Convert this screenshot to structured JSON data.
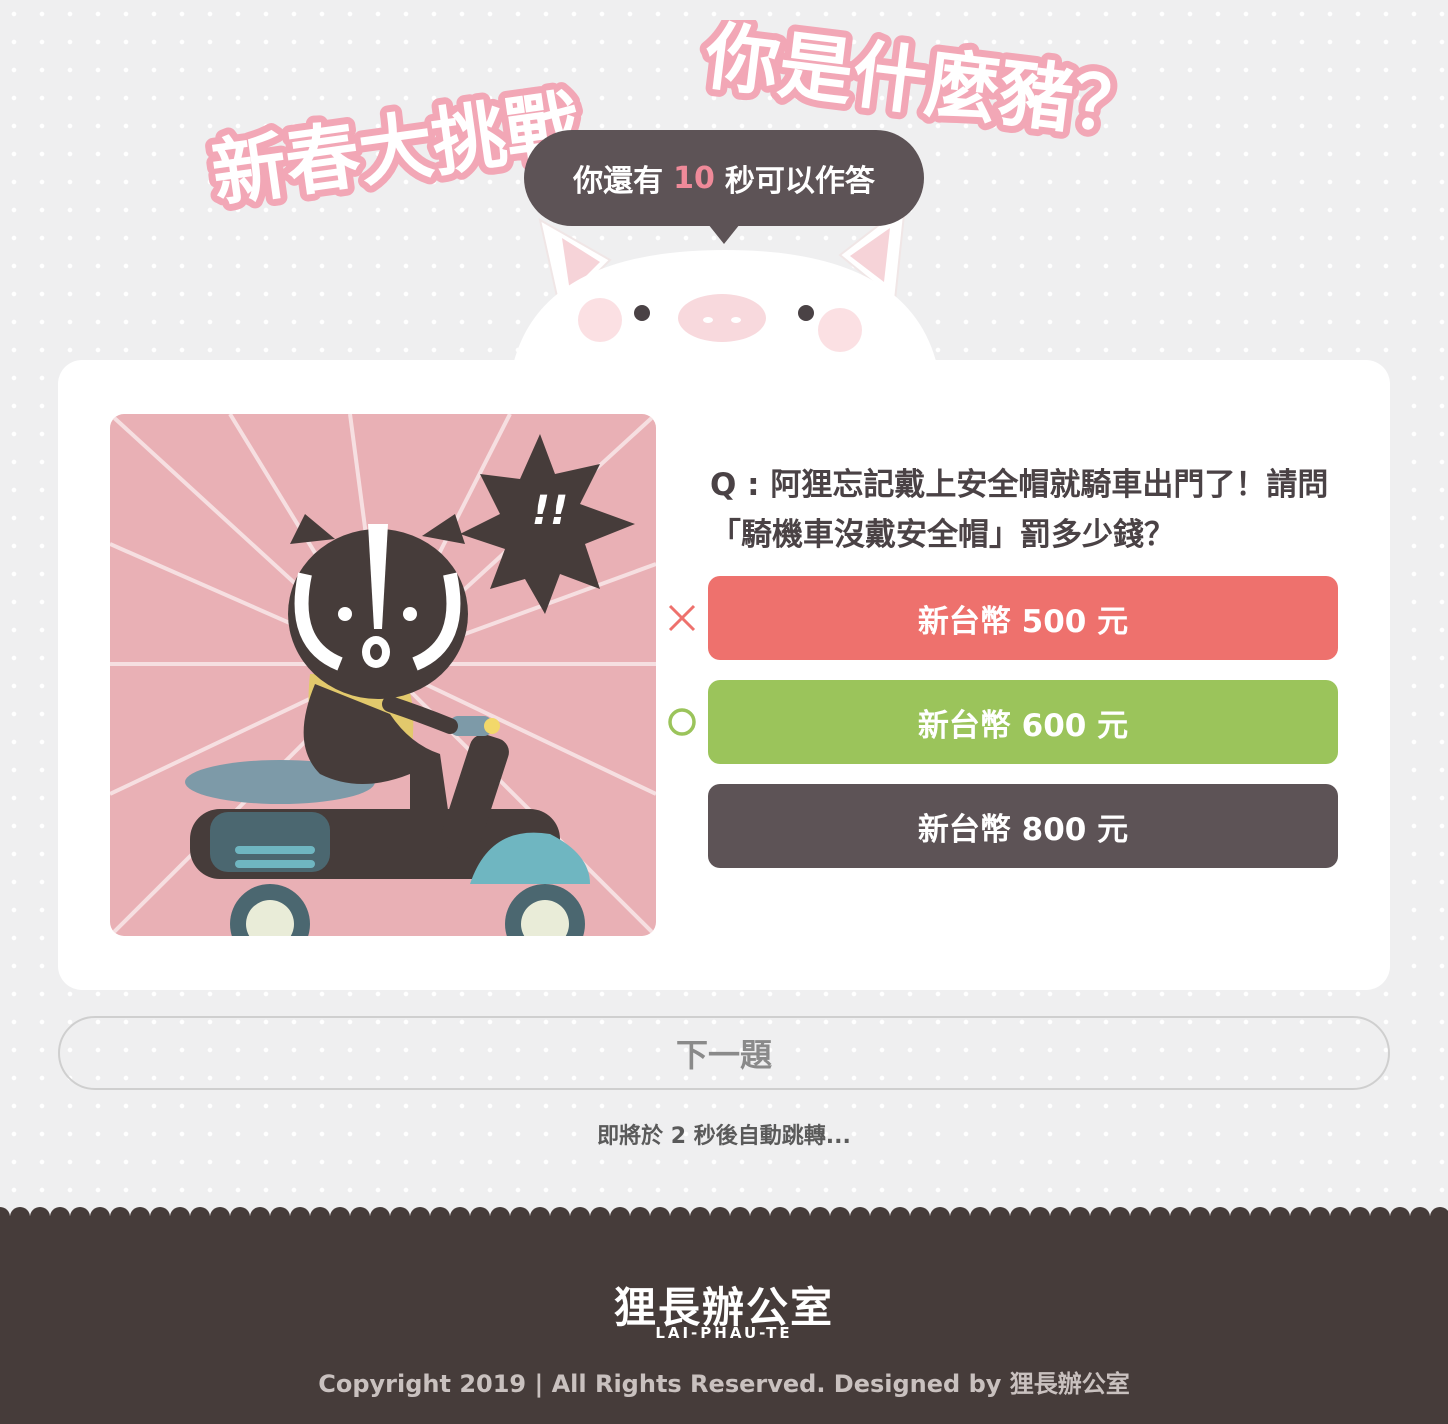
{
  "header": {
    "title_part1": "新春大挑戰",
    "title_part2": "你是什麼豬？",
    "timer_prefix": "你還有",
    "timer_seconds": "10",
    "timer_suffix": "秒可以作答"
  },
  "quiz": {
    "illustration_exclaim": "!!",
    "question": "Q : 阿狸忘記戴上安全帽就騎車出門了！請問「騎機車沒戴安全帽」罰多少錢？",
    "options": [
      {
        "label": "新台幣 500 元",
        "result": "wrong"
      },
      {
        "label": "新台幣 600 元",
        "result": "correct"
      },
      {
        "label": "新台幣 800 元",
        "result": "none"
      }
    ]
  },
  "next_button": "下一題",
  "redirect_text": "即將於 2 秒後自動跳轉...",
  "footer": {
    "logo_cn": "狸長辦公室",
    "logo_en": "LAI-PHAU-TE",
    "copyright": "Copyright 2019 | All Rights Reserved. Designed by 狸長辦公室"
  },
  "colors": {
    "wrong": "#ee716d",
    "correct": "#9bc45b",
    "neutral": "#5d5356",
    "accent_pink": "#ef8a99",
    "footer_bg": "#463c3a"
  },
  "icons": {
    "wrong_mark": "x-mark-icon",
    "correct_mark": "circle-mark-icon"
  }
}
